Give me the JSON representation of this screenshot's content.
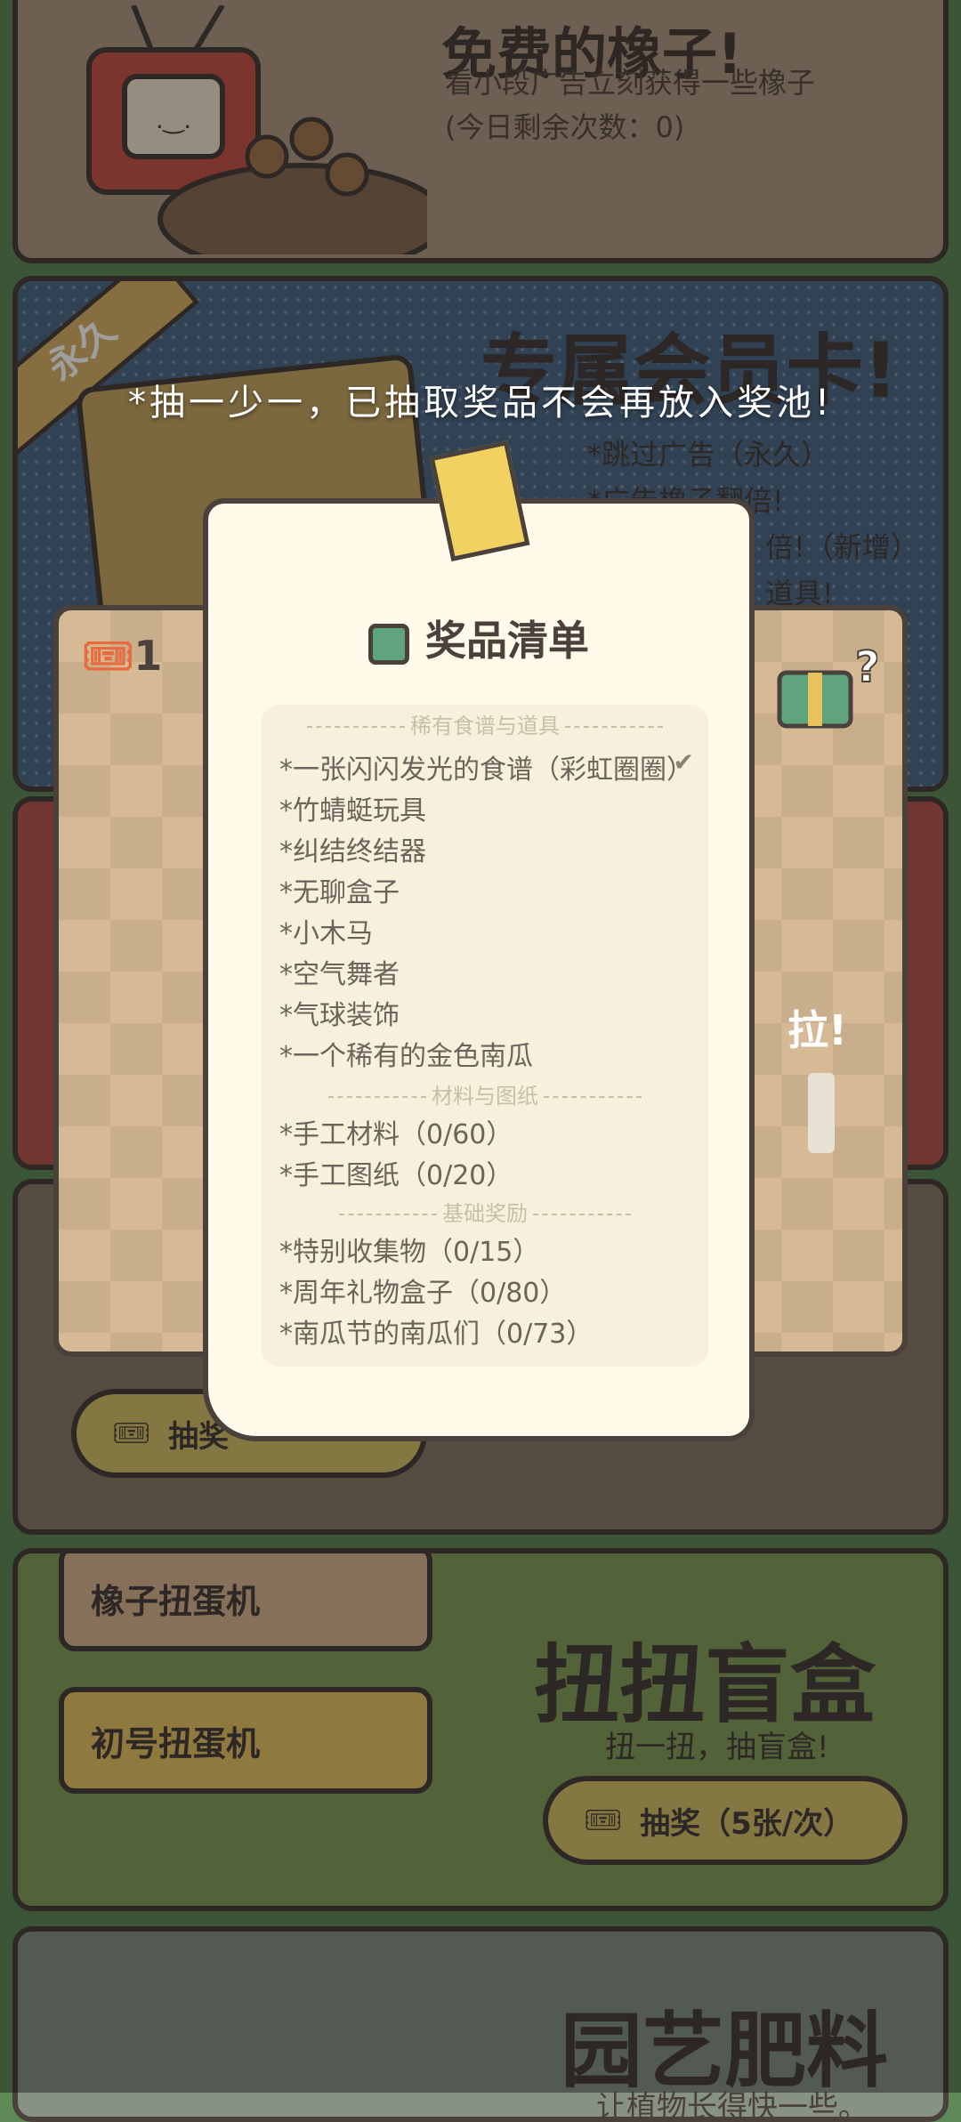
{
  "free_acorns": {
    "title": "免费的橡子!",
    "desc": "看小段广告立刻获得一些橡子",
    "remaining": "(今日剩余次数：0)"
  },
  "member_card": {
    "ribbon": "永久",
    "title": "专属会员卡!",
    "benefits": [
      "*跳过广告（永久）",
      "*广告橡子翻倍!",
      "倍!（新增）",
      "道具!"
    ]
  },
  "notice": "*抽一少一，已抽取奖品不会再放入奖池!",
  "board": {
    "ticket_count": "1",
    "pull_label": "拉!",
    "draw_label": "抽奖"
  },
  "prize_list": {
    "title": "奖品清单",
    "sections": [
      {
        "header": "稀有食谱与道具",
        "items": [
          {
            "text": "*一张闪闪发光的食谱（彩虹圈圈）",
            "checked": true
          },
          {
            "text": "*竹蜻蜓玩具"
          },
          {
            "text": "*纠结终结器"
          },
          {
            "text": "*无聊盒子"
          },
          {
            "text": "*小木马"
          },
          {
            "text": "*空气舞者"
          },
          {
            "text": "*气球装饰"
          },
          {
            "text": "*一个稀有的金色南瓜"
          }
        ]
      },
      {
        "header": "材料与图纸",
        "items": [
          {
            "text": "*手工材料（0/60）"
          },
          {
            "text": "*手工图纸（0/20）"
          }
        ]
      },
      {
        "header": "基础奖励",
        "items": [
          {
            "text": "*特别收集物（0/15）"
          },
          {
            "text": "*周年礼物盒子（0/80）"
          },
          {
            "text": "*南瓜节的南瓜们（0/73）"
          }
        ]
      }
    ]
  },
  "gacha": {
    "tab_acorn": "橡子扭蛋机",
    "tab_first": "初号扭蛋机",
    "title": "扭扭盲盒",
    "subtitle": "扭一扭，抽盲盒!",
    "draw_button": "抽奖（5张/次）"
  },
  "fertilizer": {
    "title": "园艺肥料",
    "subtitle": "让植物长得快一些。"
  }
}
